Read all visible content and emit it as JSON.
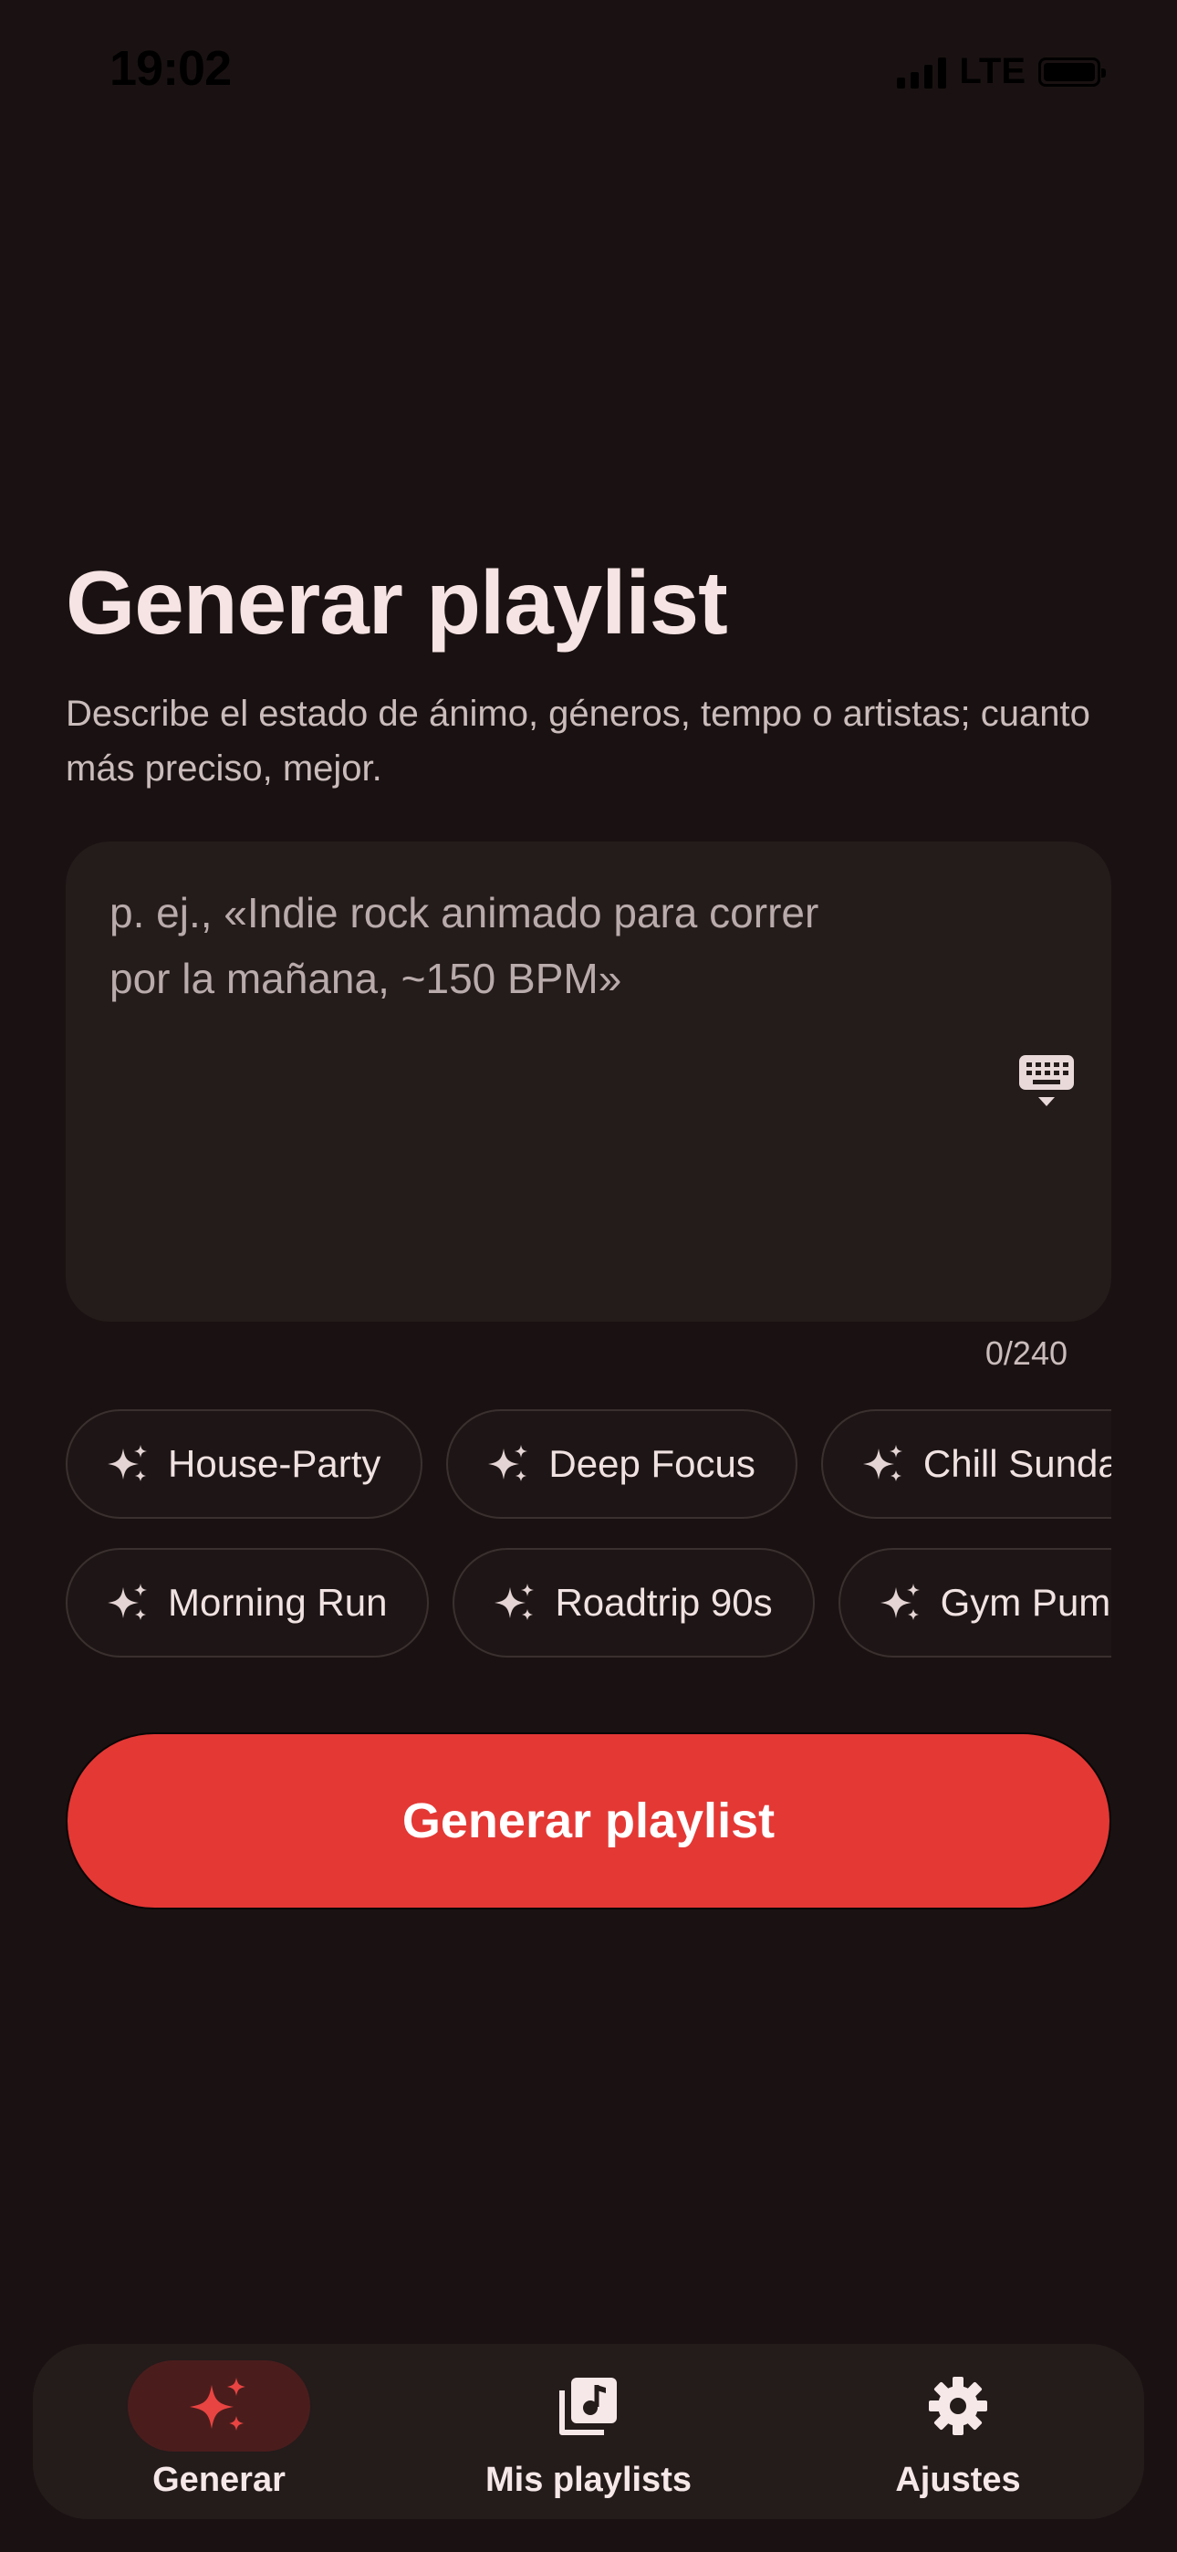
{
  "status_bar": {
    "time": "19:02",
    "network": "LTE",
    "battery_level": 1.0
  },
  "header": {
    "title": "Generar playlist",
    "subtitle": "Describe el estado de ánimo, géneros, tempo o artistas; cuanto más preciso, mejor."
  },
  "prompt": {
    "value": "",
    "placeholder": "p. ej., «Indie rock animado para correr\npor la mañana, ~150 BPM»",
    "counter": "0/240"
  },
  "suggestions": {
    "row1": [
      "House-Party",
      "Deep Focus",
      "Chill Sunday"
    ],
    "row2": [
      "Morning Run",
      "Roadtrip 90s",
      "Gym Pump"
    ]
  },
  "actions": {
    "generate_label": "Generar playlist"
  },
  "colors": {
    "background": "#1a1212",
    "surface": "#241b1b",
    "accent": "#e43835",
    "nav_active_pill": "#4a1d1c"
  },
  "bottom_nav": {
    "items": [
      {
        "label": "Generar",
        "icon": "sparkles-icon",
        "active": true
      },
      {
        "label": "Mis playlists",
        "icon": "music-library-icon",
        "active": false
      },
      {
        "label": "Ajustes",
        "icon": "gear-icon",
        "active": false
      }
    ]
  }
}
